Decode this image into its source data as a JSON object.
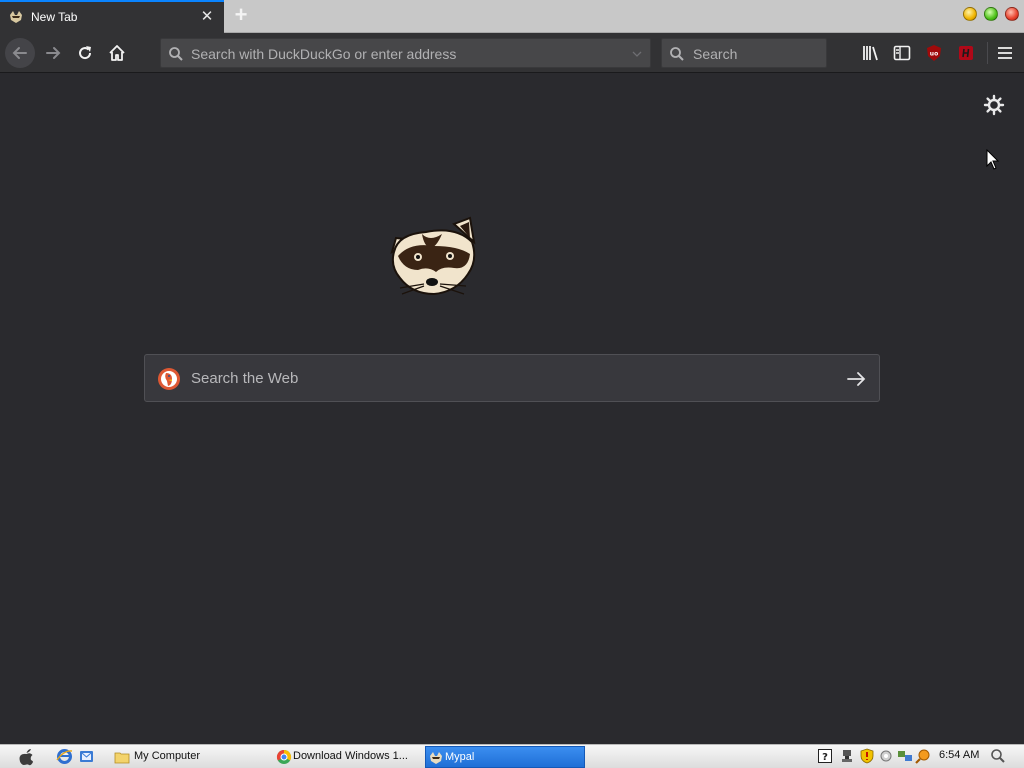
{
  "browser": {
    "tab": {
      "title": "New Tab",
      "close_glyph": "✕"
    },
    "new_tab_glyph": "+",
    "toolbar": {
      "back": "back-arrow-icon",
      "forward": "forward-arrow-icon",
      "reload": "reload-icon",
      "home": "home-icon",
      "library": "library-icon",
      "sidebar": "sidebar-icon",
      "ublock": "ublock-origin-icon",
      "hacker": "extension-h-icon",
      "menu": "hamburger-menu-icon"
    },
    "url_bar": {
      "placeholder": "Search with DuckDuckGo or enter address"
    },
    "search_bar": {
      "placeholder": "Search"
    }
  },
  "content": {
    "web_search": {
      "placeholder": "Search the Web"
    },
    "logo": "raccoon-logo"
  },
  "taskbar": {
    "items": [
      {
        "label": "My Computer"
      },
      {
        "label": "Download Windows 1..."
      },
      {
        "label": "Mypal",
        "active": true
      }
    ],
    "clock": "6:54 AM"
  },
  "colors": {
    "content_bg": "#2a2a2e",
    "toolbar_bg": "#323234",
    "tab_accent": "#0a84ff",
    "taskbar_active": "#1f6fd6"
  }
}
